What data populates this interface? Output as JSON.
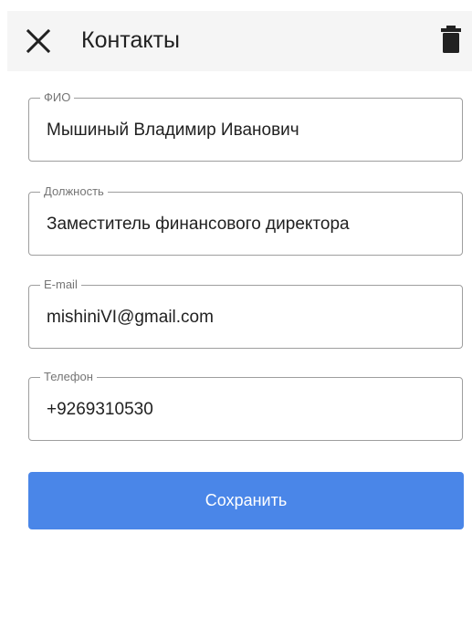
{
  "header": {
    "close_icon": "close-icon",
    "title": "Контакты",
    "delete_icon": "trash-icon"
  },
  "form": {
    "fields": [
      {
        "label": "ФИО",
        "value": "Мышиный Владимир Иванович"
      },
      {
        "label": "Должность",
        "value": "Заместитель финансового директора"
      },
      {
        "label": "E-mail",
        "value": "mishiniVI@gmail.com"
      },
      {
        "label": "Телефон",
        "value": "+9269310530"
      }
    ],
    "save_label": "Сохранить"
  },
  "colors": {
    "header_bg": "#f5f5f5",
    "primary": "#4a86e8",
    "field_border": "#9e9e9e",
    "label": "#757575",
    "text": "#212121"
  }
}
